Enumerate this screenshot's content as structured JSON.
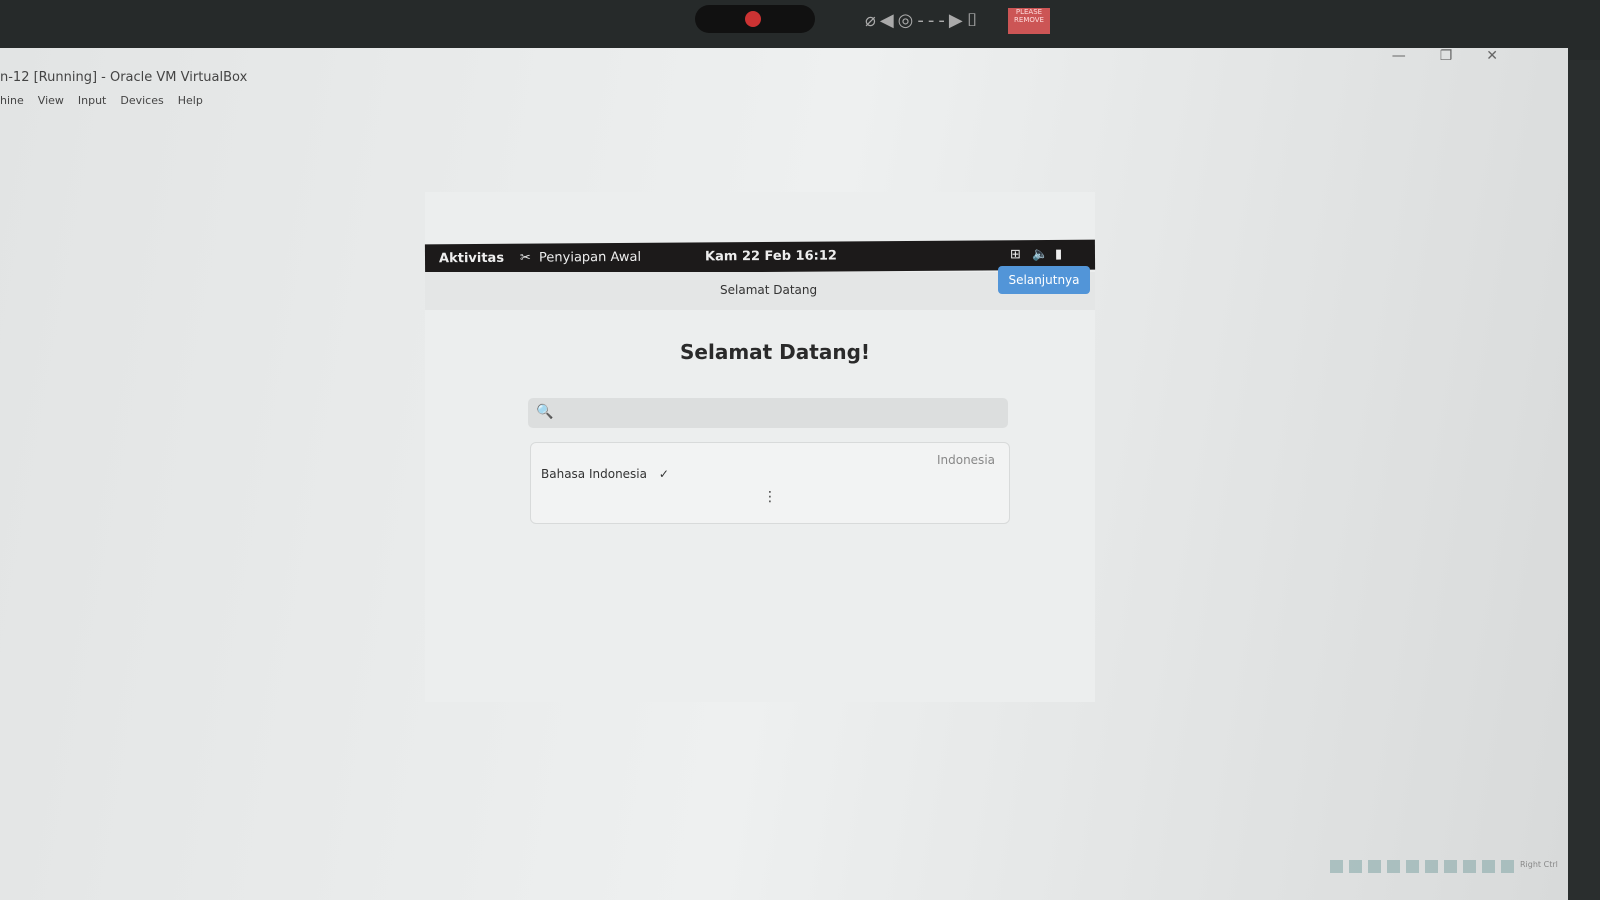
{
  "host": {
    "window_title": "n-12 [Running] - Oracle VM VirtualBox",
    "menu": [
      "hine",
      "View",
      "Input",
      "Devices",
      "Help"
    ],
    "window_controls": [
      "minimize-icon",
      "restore-icon",
      "close-icon"
    ],
    "tray_label": "Right Ctrl",
    "camera_badge": "PLEASE REMOVE"
  },
  "guest": {
    "topbar": {
      "activities": "Aktivitas",
      "app": "Penyiapan Awal",
      "clock": "Kam 22 Feb  16:12"
    },
    "header": {
      "title": "Selamat Datang",
      "next_label": "Selanjutnya"
    },
    "heading": "Selamat Datang!",
    "search": {
      "value": "",
      "placeholder": ""
    },
    "languages": [
      {
        "name": "Bahasa Indonesia",
        "check": "✓",
        "region": "Indonesia"
      }
    ],
    "more": "⋮"
  },
  "colors": {
    "accent": "#5295d8",
    "topbar": "#1c1a1a"
  }
}
